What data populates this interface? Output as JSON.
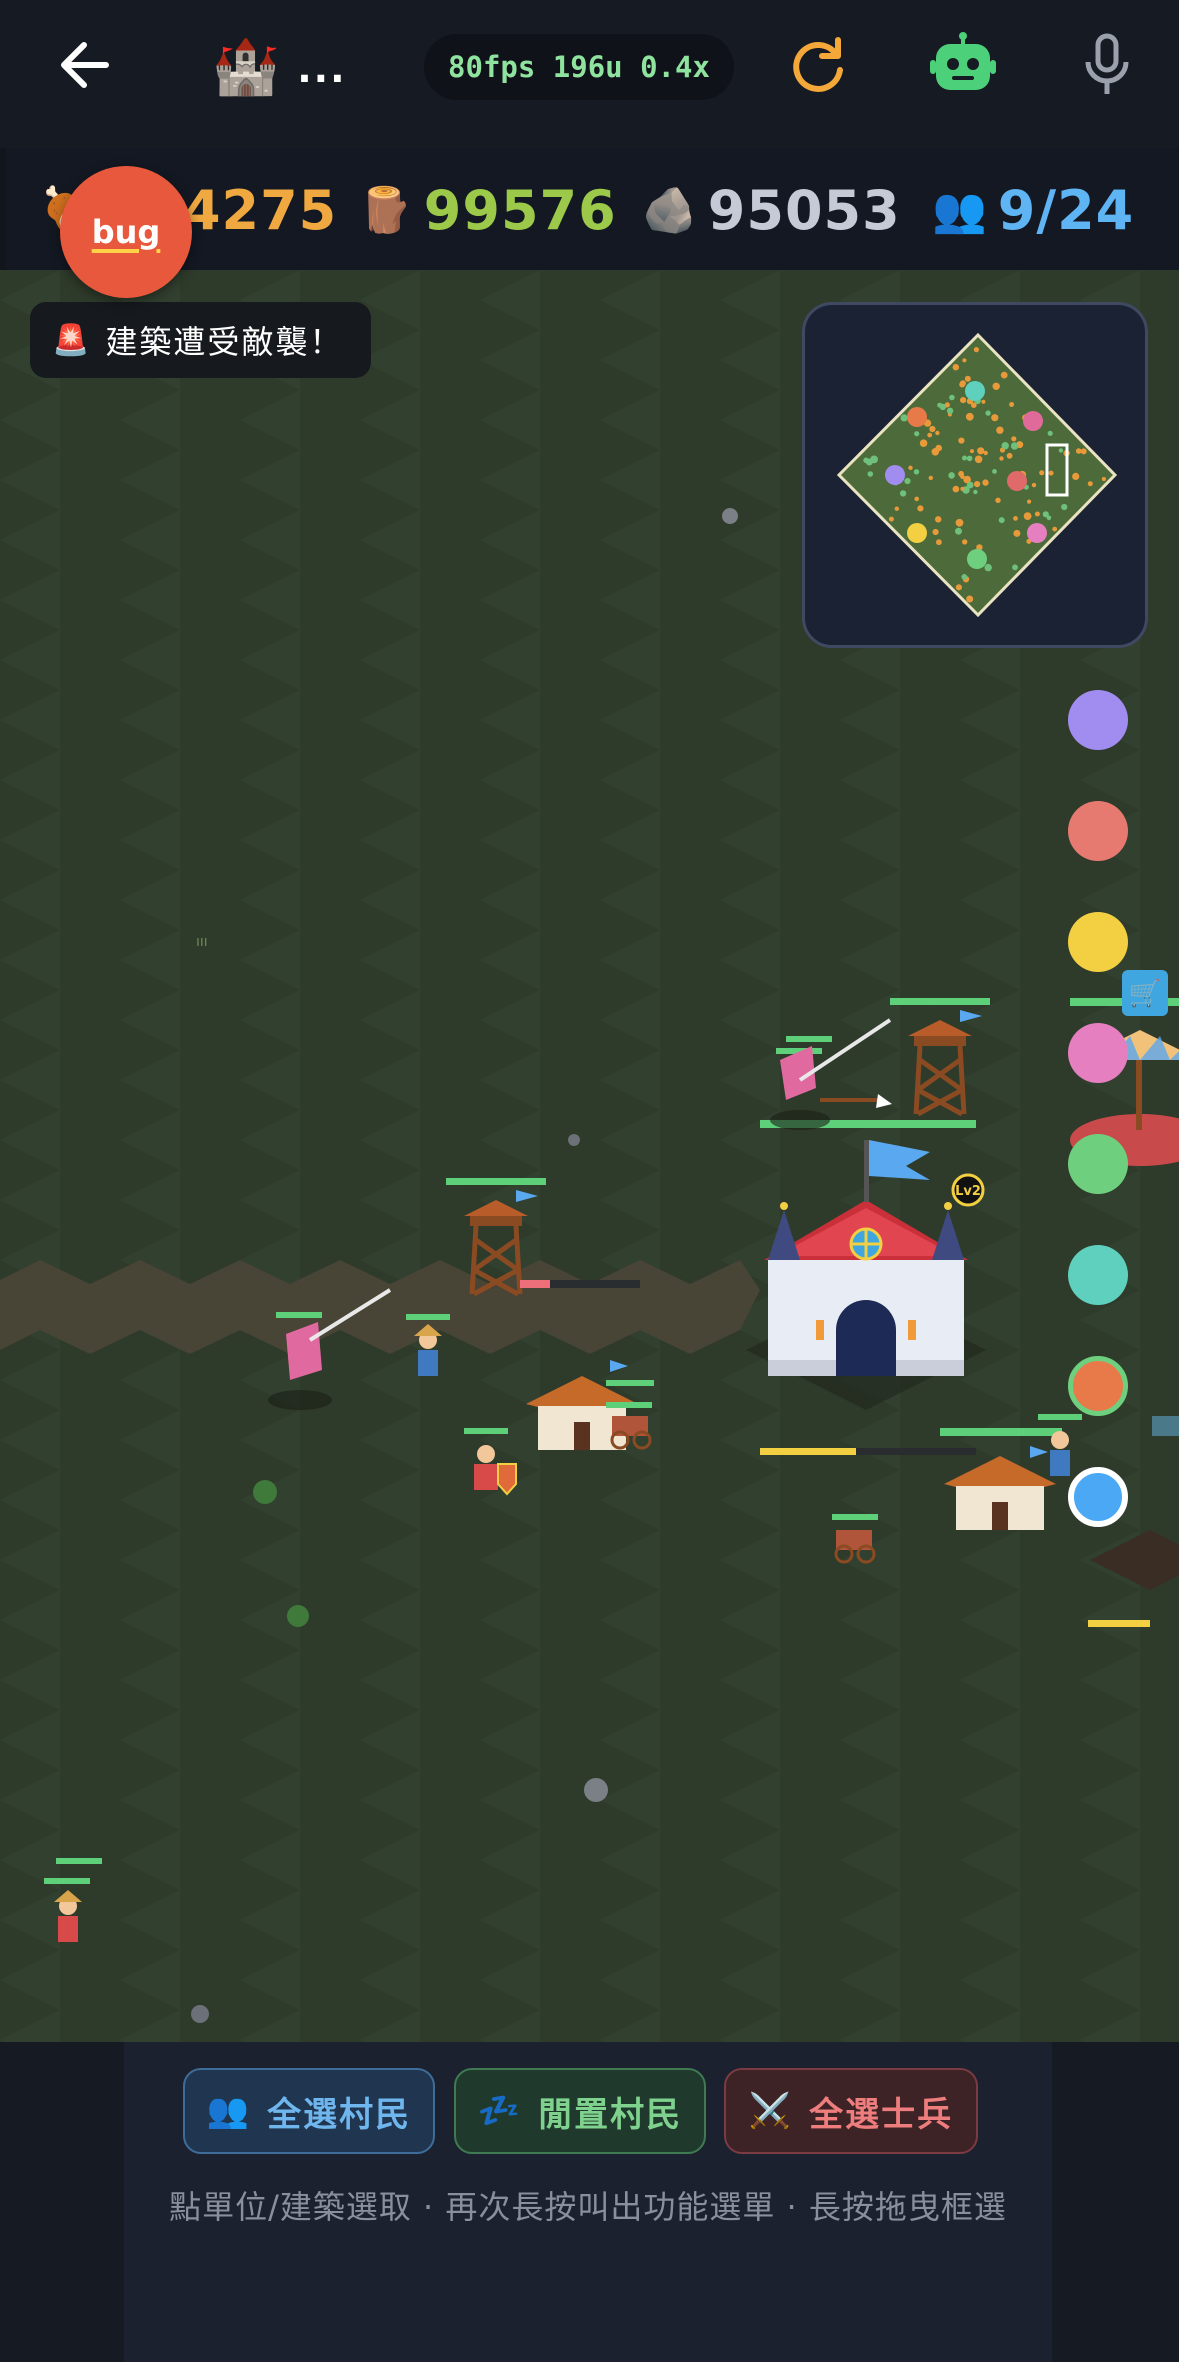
{
  "header": {
    "back_label": "back",
    "title_emoji": "🏰",
    "title_text": "...",
    "fps_text": "80fps 196u 0.4x"
  },
  "resources": {
    "food": {
      "icon": "🍖",
      "value": "104275",
      "color": "#f0a840"
    },
    "wood": {
      "icon": "🪵",
      "value": "99576",
      "color": "#9cc94a"
    },
    "stone": {
      "icon": "🪨",
      "value": "95053",
      "color": "#c5cad6"
    },
    "population": {
      "icon": "👥",
      "value": "9/24",
      "color": "#5fb4f4"
    }
  },
  "bug_badge": {
    "label": "bug"
  },
  "alert": {
    "icon": "🚨",
    "text": "建築遭受敵襲！"
  },
  "building_badge": {
    "label": "Lv2"
  },
  "player_dots": [
    {
      "name": "purple",
      "color": "#a18cf0"
    },
    {
      "name": "red",
      "color": "#e77a70"
    },
    {
      "name": "yellow",
      "color": "#f3cf42"
    },
    {
      "name": "pink",
      "color": "#e57fc0"
    },
    {
      "name": "green",
      "color": "#6ed07e"
    },
    {
      "name": "teal",
      "color": "#5fd0bd"
    },
    {
      "name": "orange-green",
      "color": "#e87a4a"
    },
    {
      "name": "blue",
      "color": "#4aa8f4"
    }
  ],
  "bottom": {
    "buttons": [
      {
        "icon": "👥",
        "label": "全選村民",
        "fg": "#6fb6ee",
        "bg": "#1f3550",
        "border": "#3f6d99"
      },
      {
        "icon": "💤",
        "label": "閒置村民",
        "fg": "#7fd28e",
        "bg": "#1f3a2c",
        "border": "#3f7a52"
      },
      {
        "icon": "⚔️",
        "label": "全選士兵",
        "fg": "#ee7d7d",
        "bg": "#3d2226",
        "border": "#7a3b42"
      }
    ],
    "hint": "點單位/建築選取 · 再次長按叫出功能選單 · 長按拖曳框選"
  },
  "colors": {
    "background": "#161a22",
    "grass": "#2e3a2a",
    "minimap_border": "#3f4a62"
  }
}
